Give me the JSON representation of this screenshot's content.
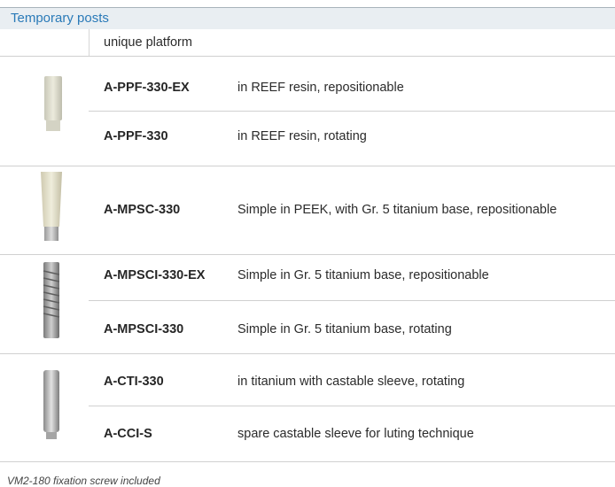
{
  "section": {
    "title": "Temporary posts"
  },
  "subheader": {
    "label": "unique platform"
  },
  "groups": [
    {
      "image": "resin-post-image",
      "rows": [
        {
          "code": "A-PPF-330-EX",
          "description": "in REEF resin, repositionable"
        },
        {
          "code": "A-PPF-330",
          "description": "in REEF resin, rotating"
        }
      ]
    },
    {
      "image": "peek-post-image",
      "rows": [
        {
          "code": "A-MPSC-330",
          "description": "Simple in PEEK, with Gr. 5 titanium base, repositionable"
        }
      ]
    },
    {
      "image": "titanium-ridged-post-image",
      "rows": [
        {
          "code": "A-MPSCI-330-EX",
          "description": "Simple in Gr. 5 titanium base, repositionable"
        },
        {
          "code": "A-MPSCI-330",
          "description": "Simple in Gr. 5 titanium base, rotating"
        }
      ]
    },
    {
      "image": "titanium-castable-post-image",
      "rows": [
        {
          "code": "A-CTI-330",
          "description": "in titanium with castable sleeve, rotating"
        },
        {
          "code": "A-CCI-S",
          "description": "spare castable sleeve for luting technique"
        }
      ]
    }
  ],
  "footnote": "VM2-180 fixation screw included"
}
